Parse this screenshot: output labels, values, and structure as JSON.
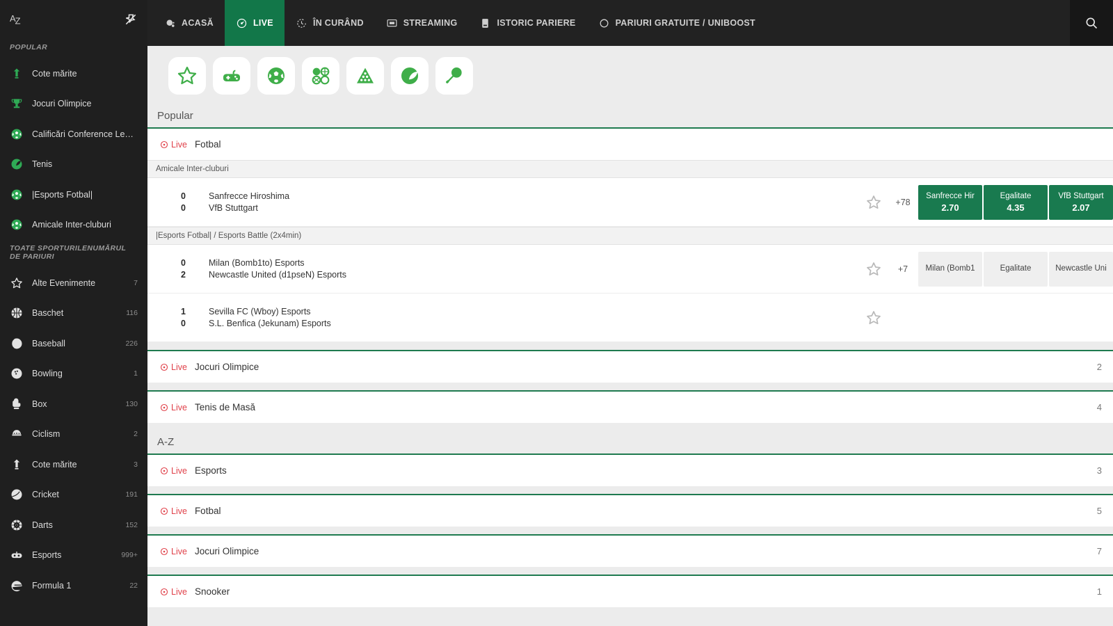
{
  "sidebar": {
    "sort_icon": "az-sort-icon",
    "pin_icon": "pin-icon",
    "popular_title": "POPULAR",
    "all_sports_title": "TOATE SPORTURILE",
    "bet_count_title": "NUMĂRUL DE PARIURI",
    "popular": [
      {
        "label": "Cote mărite",
        "icon": "boost-icon"
      },
      {
        "label": "Jocuri Olimpice",
        "icon": "trophy-icon"
      },
      {
        "label": "Calificări Conference Leag...",
        "icon": "football-icon"
      },
      {
        "label": "Tenis",
        "icon": "tennis-icon"
      },
      {
        "label": "|Esports Fotbal|",
        "icon": "football-icon"
      },
      {
        "label": "Amicale Inter-cluburi",
        "icon": "football-icon"
      }
    ],
    "sports": [
      {
        "label": "Alte Evenimente",
        "count": "7",
        "icon": "star-icon"
      },
      {
        "label": "Baschet",
        "count": "116",
        "icon": "basketball-icon"
      },
      {
        "label": "Baseball",
        "count": "226",
        "icon": "baseball-icon"
      },
      {
        "label": "Bowling",
        "count": "1",
        "icon": "bowling-icon"
      },
      {
        "label": "Box",
        "count": "130",
        "icon": "boxing-glove-icon"
      },
      {
        "label": "Ciclism",
        "count": "2",
        "icon": "cycling-icon"
      },
      {
        "label": "Cote mărite",
        "count": "3",
        "icon": "boost-icon"
      },
      {
        "label": "Cricket",
        "count": "191",
        "icon": "cricket-icon"
      },
      {
        "label": "Darts",
        "count": "152",
        "icon": "darts-icon"
      },
      {
        "label": "Esports",
        "count": "999+",
        "icon": "esports-icon"
      },
      {
        "label": "Formula 1",
        "count": "22",
        "icon": "f1-helmet-icon"
      }
    ]
  },
  "topnav": {
    "items": [
      {
        "label": "ACASĂ",
        "icon": "home-icon",
        "active": false
      },
      {
        "label": "LIVE",
        "icon": "live-clock-icon",
        "active": true
      },
      {
        "label": "ÎN CURÂND",
        "icon": "upcoming-clock-icon",
        "active": false
      },
      {
        "label": "STREAMING",
        "icon": "stream-monitor-icon",
        "active": false
      },
      {
        "label": "ISTORIC PARIERE",
        "icon": "bet-history-icon",
        "active": false
      },
      {
        "label": "PARIURI GRATUITE / UNIBOOST",
        "icon": "freebet-circle-icon",
        "active": false
      }
    ],
    "search_icon": "search-icon",
    "active_color": "#127749"
  },
  "chips": [
    {
      "name": "favourites-chip",
      "icon": "star-outline-icon"
    },
    {
      "name": "esports-chip",
      "icon": "gamepad-icon"
    },
    {
      "name": "football-chip",
      "icon": "football-icon"
    },
    {
      "name": "all-sports-chip",
      "icon": "four-balls-icon"
    },
    {
      "name": "snooker-chip",
      "icon": "snooker-rack-icon"
    },
    {
      "name": "tennis-chip",
      "icon": "tennis-ball-icon"
    },
    {
      "name": "table-tennis-chip",
      "icon": "table-tennis-paddle-icon"
    }
  ],
  "sections": [
    {
      "title": "Popular",
      "blocks": [
        {
          "live_label": "Live",
          "sport": "Fotbal",
          "count": "",
          "leagues": [
            {
              "name": "Amicale Inter-cluburi",
              "matches": [
                {
                  "score_home": "0",
                  "score_away": "0",
                  "team_home": "Sanfrecce Hiroshima",
                  "team_away": "VfB Stuttgart",
                  "star_icon": "star-outline-icon",
                  "more_count": "+78",
                  "odds_style": "green",
                  "odds": [
                    {
                      "label": "Sanfrecce Hir",
                      "value": "2.70"
                    },
                    {
                      "label": "Egalitate",
                      "value": "4.35"
                    },
                    {
                      "label": "VfB Stuttgart",
                      "value": "2.07"
                    }
                  ]
                }
              ]
            },
            {
              "name": "|Esports Fotbal| / Esports Battle (2x4min)",
              "matches": [
                {
                  "score_home": "0",
                  "score_away": "2",
                  "team_home": "Milan (Bomb1to) Esports",
                  "team_away": "Newcastle United (d1pseN) Esports",
                  "star_icon": "star-outline-icon",
                  "more_count": "+7",
                  "odds_style": "grey",
                  "odds": [
                    {
                      "label": "Milan (Bomb1",
                      "value": ""
                    },
                    {
                      "label": "Egalitate",
                      "value": ""
                    },
                    {
                      "label": "Newcastle Uni",
                      "value": ""
                    }
                  ]
                },
                {
                  "score_home": "1",
                  "score_away": "0",
                  "team_home": "Sevilla FC (Wboy) Esports",
                  "team_away": "S.L. Benfica (Jekunam) Esports",
                  "star_icon": "star-outline-icon",
                  "more_count": "",
                  "odds_style": "none",
                  "odds": []
                }
              ]
            }
          ]
        },
        {
          "live_label": "Live",
          "sport": "Jocuri Olimpice",
          "count": "2",
          "leagues": []
        },
        {
          "live_label": "Live",
          "sport": "Tenis de Masă",
          "count": "4",
          "leagues": []
        }
      ]
    },
    {
      "title": "A-Z",
      "blocks": [
        {
          "live_label": "Live",
          "sport": "Esports",
          "count": "3",
          "leagues": []
        },
        {
          "live_label": "Live",
          "sport": "Fotbal",
          "count": "5",
          "leagues": []
        },
        {
          "live_label": "Live",
          "sport": "Jocuri Olimpice",
          "count": "7",
          "leagues": []
        },
        {
          "live_label": "Live",
          "sport": "Snooker",
          "count": "1",
          "leagues": []
        }
      ]
    }
  ]
}
